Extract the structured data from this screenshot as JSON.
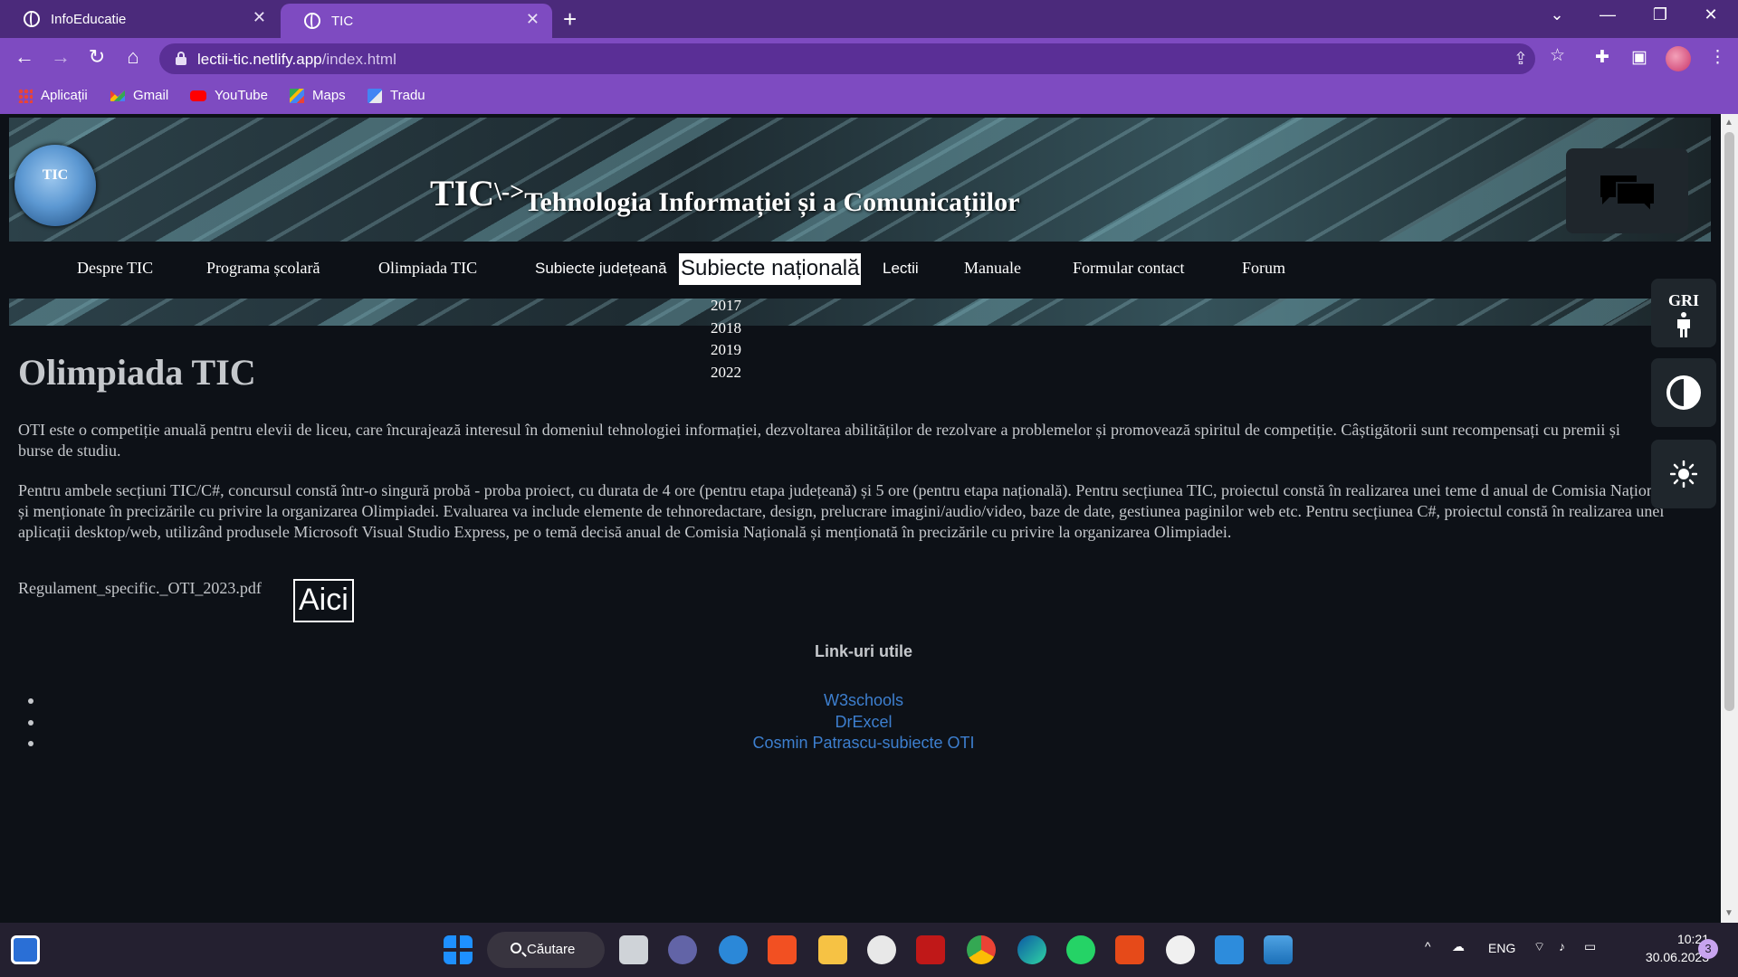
{
  "browser": {
    "tabs": [
      {
        "title": "InfoEducatie",
        "active": false
      },
      {
        "title": "TIC",
        "active": true
      }
    ],
    "url_host": "lectii-tic.netlify.app",
    "url_path": "/index.html",
    "bookmarks": [
      {
        "label": "Aplicații",
        "icon": "apps-grid-icon"
      },
      {
        "label": "Gmail",
        "icon": "gmail-icon"
      },
      {
        "label": "YouTube",
        "icon": "youtube-icon"
      },
      {
        "label": "Maps",
        "icon": "maps-icon"
      },
      {
        "label": "Tradu",
        "icon": "translate-icon"
      }
    ]
  },
  "site": {
    "logo_text": "TIC",
    "title_big": "TIC",
    "title_arrow": "\\->",
    "title_rest": "Tehnologia Informației și a Comunicațiilor"
  },
  "nav": {
    "items": [
      {
        "label": "Despre TIC"
      },
      {
        "label": "Programa școlară"
      },
      {
        "label": "Olimpiada TIC"
      },
      {
        "label": "Subiecte județeană"
      },
      {
        "label": "Subiecte națională"
      },
      {
        "label": "Lectii"
      },
      {
        "label": "Manuale"
      },
      {
        "label": "Formular contact"
      },
      {
        "label": "Forum"
      }
    ],
    "dropdown": [
      "2017",
      "2018",
      "2019",
      "2022"
    ]
  },
  "main": {
    "heading": "Olimpiada TIC",
    "paragraph1": "OTI este o competiție anuală pentru elevii de liceu, care încurajează interesul în domeniul tehnologiei informației, dezvoltarea abilităților de rezolvare a problemelor și promovează spiritul de competiție. Câștigătorii sunt recompensați cu premii și burse de studiu.",
    "paragraph2": "Pentru ambele secțiuni TIC/C#, concursul constă într-o singură probă - proba proiect, cu durata de 4 ore (pentru etapa județeană) și 5 ore (pentru etapa națională). Pentru secțiunea TIC, proiectul constă în realizarea unei teme d anual de Comisia Națională și menționate în precizările cu privire la organizarea Olimpiadei. Evaluarea va include elemente de tehnoredactare, design, prelucrare imagini/audio/video, baze de date, gestiunea paginilor web etc. Pentru secțiunea C#, proiectul constă în realizarea unei aplicații desktop/web, utilizând produsele Microsoft Visual Studio Express, pe o temă decisă anual de Comisia Națională și menționată în precizările cu privire la organizarea Olimpiadei.",
    "regulament": "Regulament_specific._OTI_2023.pdf",
    "aici": "Aici",
    "links_title": "Link-uri utile",
    "links": [
      "W3schools",
      "DrExcel",
      "Cosmin Patrascu-subiecte OTI"
    ]
  },
  "a11y": {
    "gri_label": "GRI"
  },
  "taskbar": {
    "search_label": "Căutare",
    "language": "ENG",
    "time": "10:21",
    "date": "30.06.2023",
    "notifications": "3"
  },
  "colors": {
    "tabstrip": "#4b2a7b",
    "toolbar": "#7e4bc1",
    "page_bg": "#0d1117",
    "link": "#3d7fcf",
    "text": "#c5c8cc"
  }
}
